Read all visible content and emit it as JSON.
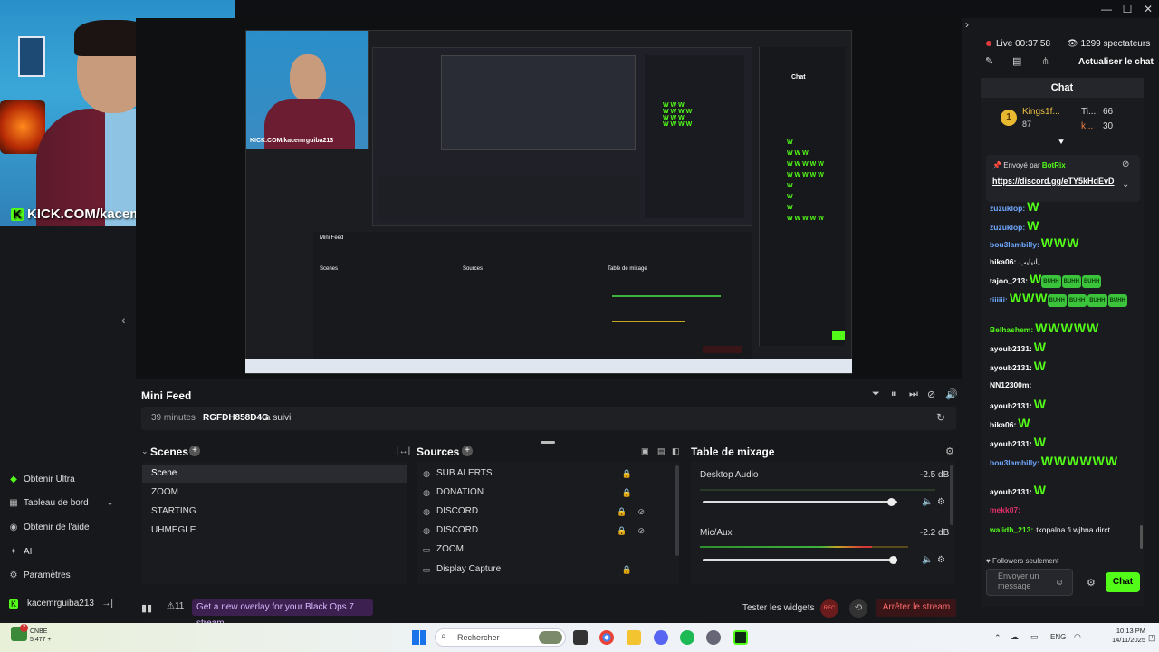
{
  "webcam": {
    "overlay_text": "KICK.COM/kacemrguiba213"
  },
  "window_controls": [
    "—",
    "☐",
    "✕"
  ],
  "nav": {
    "items": [
      {
        "label": "Obtenir Ultra",
        "icon": "ultra-icon"
      },
      {
        "label": "Tableau de bord",
        "icon": "dashboard-icon"
      },
      {
        "label": "Obtenir de l'aide",
        "icon": "help-icon"
      },
      {
        "label": "AI",
        "icon": "ai-icon"
      },
      {
        "label": "Paramètres",
        "icon": "gear-icon"
      }
    ],
    "user": "kacemrguiba213"
  },
  "minifeed": {
    "title": "Mini Feed",
    "time": "39 minutes",
    "user": "RGFDH858D4G",
    "action": "a suivi"
  },
  "scenes": {
    "title": "Scenes",
    "items": [
      "Scene",
      "ZOOM",
      "STARTING",
      "UHMEGLE"
    ]
  },
  "sources": {
    "title": "Sources",
    "items": [
      "SUB ALERTS",
      "DONATION",
      "DISCORD",
      "DISCORD",
      "ZOOM",
      "Display Capture"
    ]
  },
  "mixer": {
    "title": "Table de mixage",
    "channels": [
      {
        "name": "Desktop Audio",
        "db": "-2.5 dB",
        "level": 0.95
      },
      {
        "name": "Mic/Aux",
        "db": "-2.2 dB",
        "level": 0.96
      }
    ]
  },
  "bottombar": {
    "alerts": "11",
    "promo": "Get a new overlay for your Black Ops 7 stream.",
    "test_widgets": "Tester les widgets",
    "stop_stream": "Arrêter le stream"
  },
  "stream": {
    "live": "Live 00:37:58",
    "viewers": "1299 spectateurs",
    "refresh": "Actualiser le chat"
  },
  "chat": {
    "title": "Chat",
    "gifts": [
      {
        "rank": "1",
        "name": "Kings1f...",
        "score": "87"
      },
      {
        "name": "Ti...",
        "score": "66"
      },
      {
        "name": "k...",
        "score": "30"
      }
    ],
    "pinned": {
      "by": "Envoyé par",
      "bot": "BotRix",
      "link": "https://discord.gg/eTY5kHdEvD"
    },
    "messages": [
      {
        "user": "zuzuklop:",
        "color": "#6fa8ff",
        "text": "",
        "w": 1,
        "emotes": []
      },
      {
        "user": "zuzuklop:",
        "color": "#6fa8ff",
        "text": "",
        "w": 1,
        "emotes": []
      },
      {
        "user": "bou3lambilly:",
        "color": "#6fa8ff",
        "text": "",
        "w": 3,
        "emotes": []
      },
      {
        "user": "bika06:",
        "color": "#ffffff",
        "text": "يانيايب",
        "w": 0,
        "emotes": []
      },
      {
        "user": "tajoo_213:",
        "color": "#ffffff",
        "text": "",
        "w": 1,
        "emotes": [
          "BUHH",
          "BUHH",
          "BUHH"
        ]
      },
      {
        "user": "tiiiiii:",
        "color": "#6fa8ff",
        "text": "",
        "w": 3,
        "emotes": [
          "BUHH",
          "BUHH",
          "BUHH",
          "BUHH"
        ]
      },
      {
        "user": "Belhashem:",
        "color": "#53fc18",
        "text": "",
        "w": 5,
        "emotes": []
      },
      {
        "user": "ayoub2131:",
        "color": "#ffffff",
        "text": "",
        "w": 1,
        "emotes": []
      },
      {
        "user": "ayoub2131:",
        "color": "#ffffff",
        "text": "",
        "w": 1,
        "emotes": []
      },
      {
        "user": "NN12300m:",
        "color": "#ffffff",
        "text": "",
        "w": 0,
        "emotes": []
      },
      {
        "user": "ayoub2131:",
        "color": "#ffffff",
        "text": "",
        "w": 1,
        "emotes": []
      },
      {
        "user": "bika06:",
        "color": "#ffffff",
        "text": "",
        "w": 1,
        "emotes": []
      },
      {
        "user": "ayoub2131:",
        "color": "#ffffff",
        "text": "",
        "w": 1,
        "emotes": []
      },
      {
        "user": "bou3lambilly:",
        "color": "#6fa8ff",
        "text": "",
        "w": 6,
        "emotes": []
      },
      {
        "user": "ayoub2131:",
        "color": "#ffffff",
        "text": "",
        "w": 1,
        "emotes": []
      },
      {
        "user": "mekk07:",
        "color": "#e0306a",
        "text": "",
        "w": 0,
        "emotes": []
      },
      {
        "user": "walidb_213:",
        "color": "#53fc18",
        "text": "tkopalna fi wjhna dirct",
        "w": 0,
        "emotes": []
      }
    ],
    "followers_only": "Followers seulement",
    "input_placeholder": "Envoyer un message",
    "send": "Chat"
  },
  "taskbar": {
    "weather_temp": "CNBE",
    "weather_sub": "5,477 +",
    "search": "Rechercher",
    "lang": "ENG",
    "time": "10:13 PM",
    "date": "14/11/2025"
  },
  "colors": {
    "accent": "#53fc18",
    "danger": "#ff6a6a",
    "link": "#6fa8ff"
  }
}
